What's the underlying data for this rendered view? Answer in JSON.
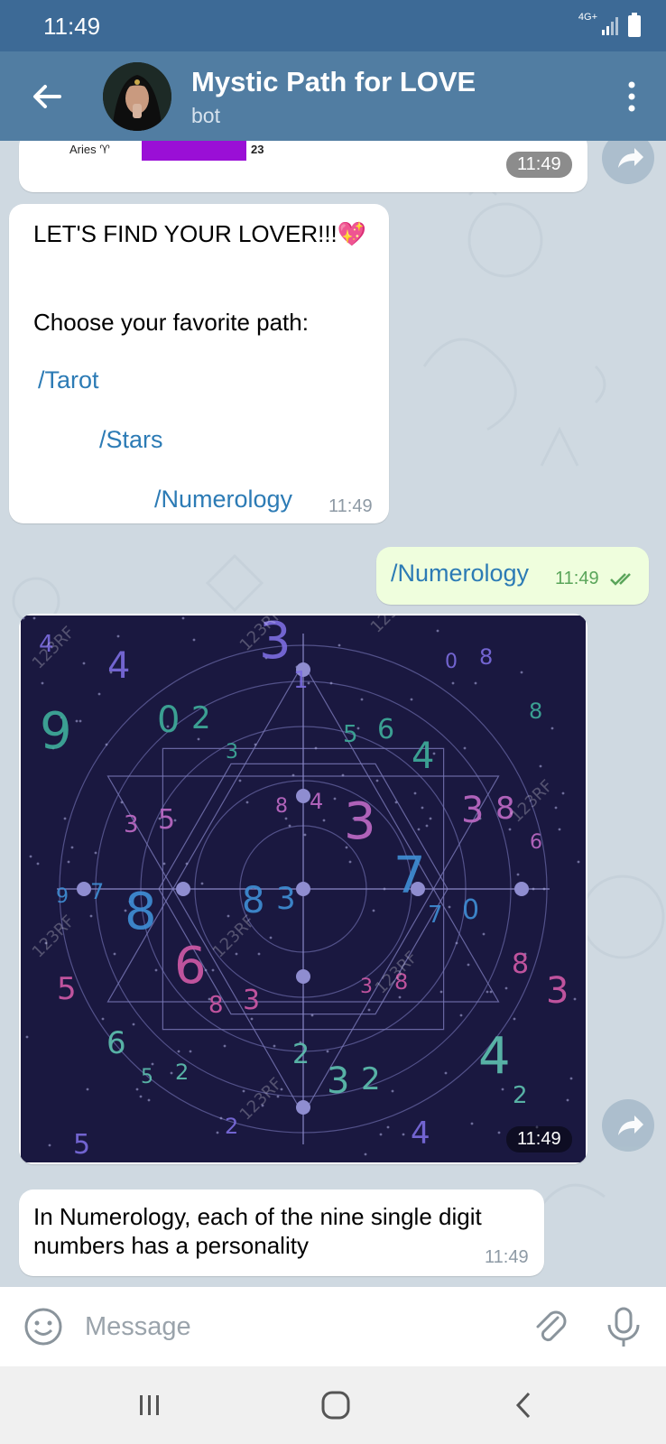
{
  "status": {
    "time": "11:49",
    "network": "4G+"
  },
  "header": {
    "title": "Mystic Path for LOVE",
    "subtitle": "bot"
  },
  "messages": {
    "card_partial": {
      "label": "Aries ♈",
      "value": "23",
      "time": "11:49",
      "bar_color": "#9a0fd6"
    },
    "menu": {
      "line1": "LET'S FIND YOUR LOVER!!!💖",
      "line2": "Choose your favorite path:",
      "cmd_tarot": "/Tarot",
      "cmd_stars": "/Stars",
      "cmd_numerology": "/Numerology",
      "time": "11:49"
    },
    "user_reply": {
      "text": "/Numerology",
      "time": "11:49"
    },
    "image": {
      "time": "11:49",
      "watermark": "123RF",
      "digits": [
        "4",
        "0",
        "8",
        "7",
        "8",
        "6",
        "2",
        "5",
        "3",
        "9",
        "6",
        "2",
        "4",
        "8",
        "3",
        "8",
        "3",
        "4",
        "5",
        "2",
        "4",
        "7",
        "3",
        "5",
        "3",
        "6",
        "8",
        "7",
        "8",
        "3",
        "0",
        "9",
        "5",
        "3",
        "8",
        "2",
        "4",
        "3",
        "3",
        "0",
        "5",
        "2",
        "1",
        "4",
        "6",
        "8",
        "3",
        "2",
        "8"
      ]
    },
    "numerology_text": {
      "text": "In Numerology, each of the nine single digit numbers has a personality",
      "time": "11:49"
    }
  },
  "input": {
    "placeholder": "Message"
  },
  "colors": {
    "header": "#517da2",
    "statusbar": "#3d6a96",
    "link": "#2c7bb5",
    "out_bubble": "#effedd",
    "image_bg": "#1a1840"
  }
}
